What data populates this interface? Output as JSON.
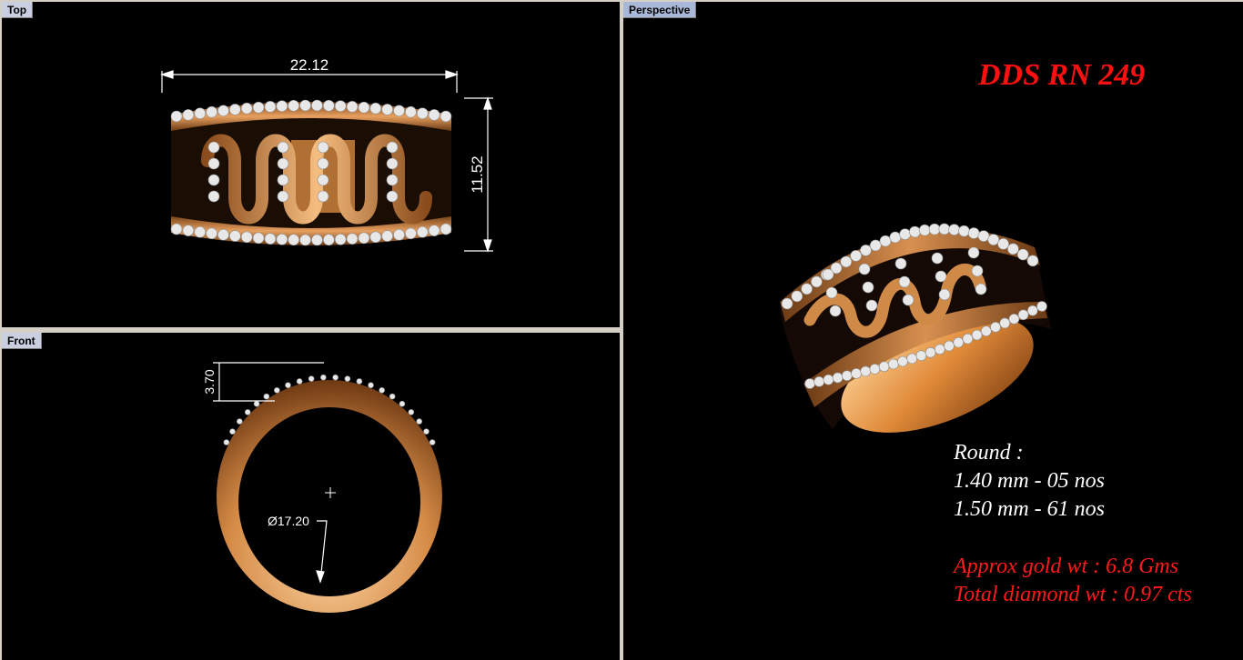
{
  "viewports": {
    "top": {
      "label": "Top",
      "width_dim": "22.12",
      "height_dim": "11.52"
    },
    "front": {
      "label": "Front",
      "height_dim": "3.70",
      "diameter_dim": "Ø17.20"
    },
    "perspective": {
      "label": "Perspective"
    }
  },
  "product": {
    "code": "DDS RN 249",
    "stones_heading": "Round :",
    "stone_lines": [
      "1.40 mm - 05 nos",
      "1.50 mm - 61 nos"
    ],
    "gold_weight": "Approx gold wt : 6.8 Gms",
    "diamond_weight": "Total diamond wt : 0.97 cts"
  },
  "colors": {
    "gold": "#c8813f",
    "gold_light": "#f2b878",
    "diamond": "#e8e8e8",
    "annotation_red": "#ff1010",
    "dimension_white": "#ffffff"
  }
}
